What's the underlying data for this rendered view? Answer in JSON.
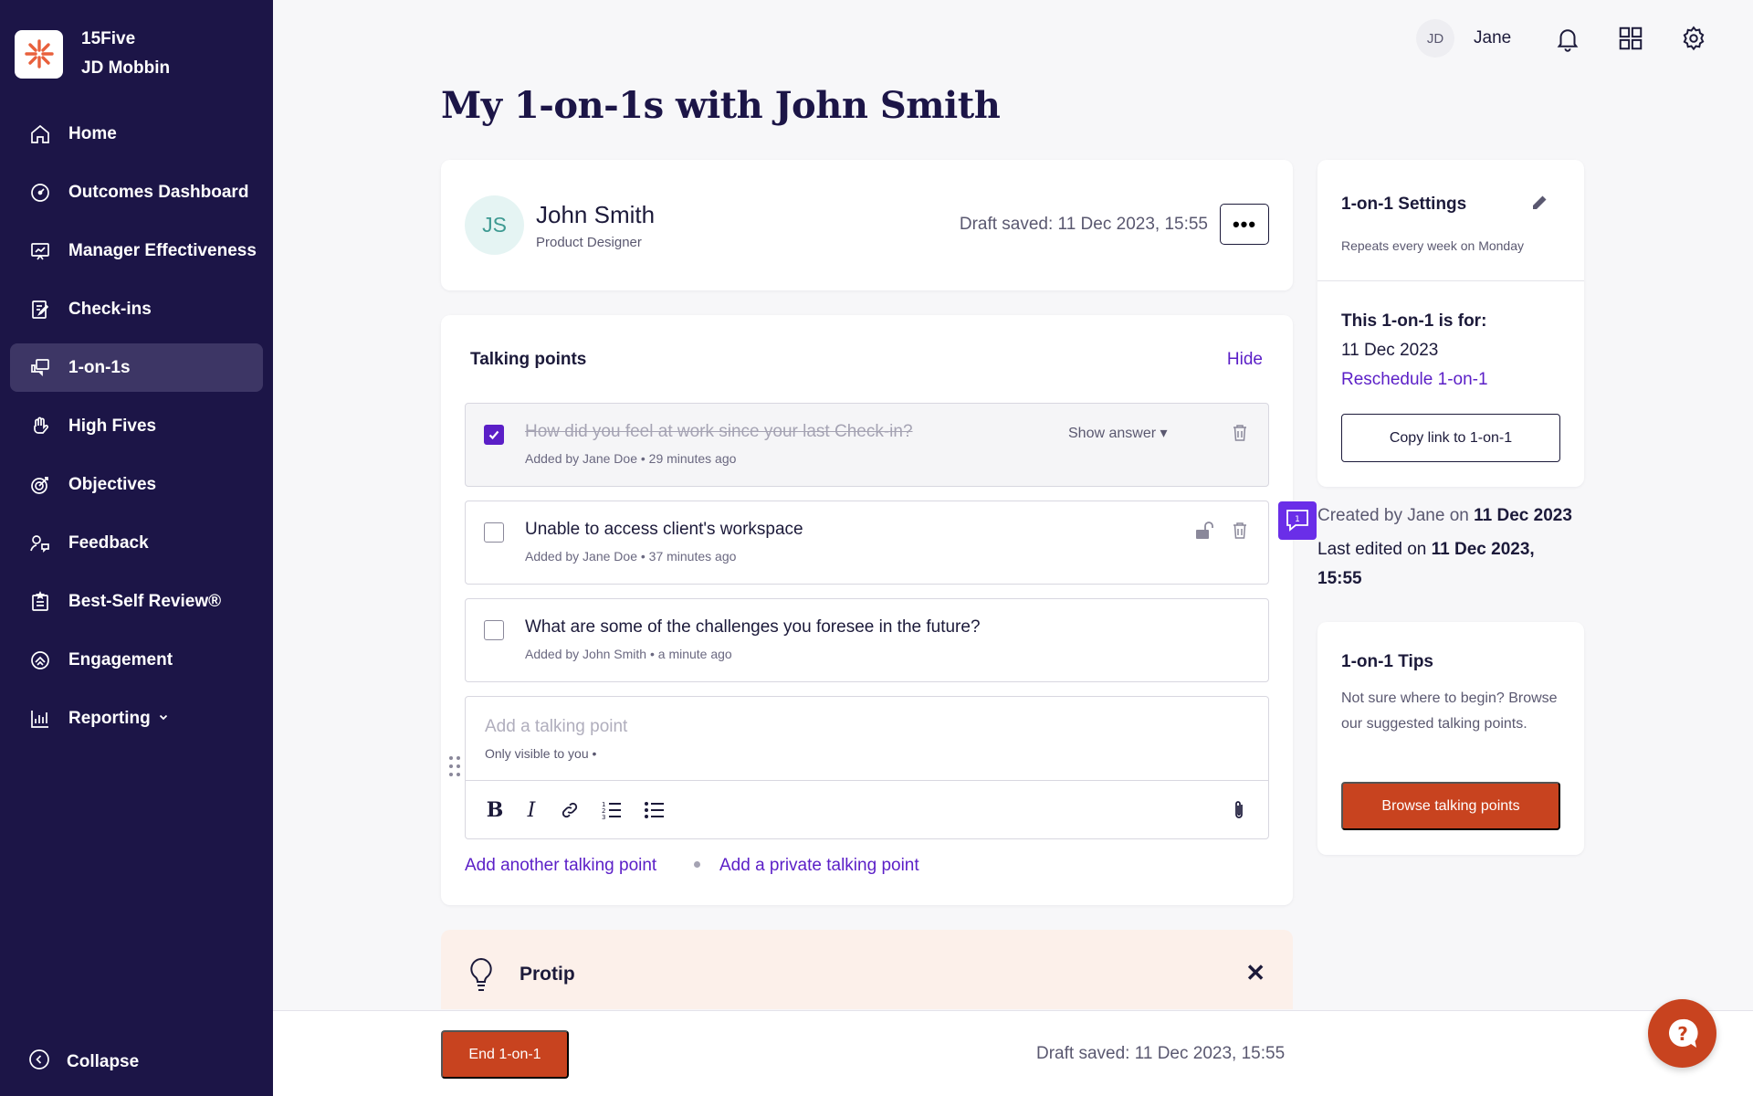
{
  "brand": {
    "company": "15Five",
    "user": "JD Mobbin"
  },
  "sidebar": {
    "items": [
      {
        "label": "Home",
        "icon": "home-icon"
      },
      {
        "label": "Outcomes Dashboard",
        "icon": "dashboard-gauge-icon"
      },
      {
        "label": "Manager Effectiveness",
        "icon": "chart-presentation-icon"
      },
      {
        "label": "Check-ins",
        "icon": "checkin-edit-icon"
      },
      {
        "label": "1-on-1s",
        "icon": "chat-bubbles-icon",
        "active": true
      },
      {
        "label": "High Fives",
        "icon": "high-five-hand-icon"
      },
      {
        "label": "Objectives",
        "icon": "target-icon"
      },
      {
        "label": "Feedback",
        "icon": "feedback-person-icon"
      },
      {
        "label": "Best-Self Review®",
        "icon": "review-clipboard-icon"
      },
      {
        "label": "Engagement",
        "icon": "engagement-icon"
      },
      {
        "label": "Reporting",
        "icon": "bar-chart-icon"
      }
    ],
    "collapse_label": "Collapse"
  },
  "topbar": {
    "avatar_initials": "JD",
    "user_name": "Jane"
  },
  "page": {
    "title": "My 1-on-1s with John Smith"
  },
  "person": {
    "initials": "JS",
    "name": "John Smith",
    "role": "Product Designer",
    "draft_saved": "Draft saved: 11 Dec 2023, 15:55",
    "more_label": "•••"
  },
  "talking_points": {
    "title": "Talking points",
    "hide_label": "Hide",
    "items": [
      {
        "text": "How did you feel at work since your last Check-in?",
        "meta": "Added by Jane Doe  •  29 minutes ago",
        "checked": true,
        "show_answer": "Show answer ▾"
      },
      {
        "text": "Unable to access client's workspace",
        "meta": "Added by Jane Doe  •  37 minutes ago",
        "checked": false
      },
      {
        "text": "What are some of the challenges you foresee in the future?",
        "meta": "Added by John Smith  •  a minute ago",
        "checked": false
      }
    ],
    "add_placeholder": "Add a talking point",
    "add_visibility": "Only visible to you  •",
    "add_another": "Add another talking point",
    "add_private": "Add a private talking point"
  },
  "protip": {
    "title": "Protip",
    "close": "✕"
  },
  "footer": {
    "end_label": "End 1-on-1",
    "draft_saved": "Draft saved: 11 Dec 2023, 15:55"
  },
  "settings": {
    "title": "1-on-1 Settings",
    "repeat": "Repeats every week on Monday",
    "for_label": "This 1-on-1 is for:",
    "for_date": "11 Dec 2023",
    "reschedule": "Reschedule 1-on-1",
    "copy_link": "Copy link to 1-on-1"
  },
  "history": {
    "created_prefix": "Created by Jane on ",
    "created_date": "11 Dec 2023",
    "edited_prefix": "Last edited on ",
    "edited_date": "11 Dec 2023, 15:55",
    "comment_count": "1"
  },
  "tips": {
    "title": "1-on-1 Tips",
    "body": "Not sure where to begin? Browse our suggested talking points.",
    "browse": "Browse talking points"
  },
  "colors": {
    "sidebar_bg": "#1c1547",
    "accent": "#5b1fc7",
    "primary_button": "#c8431f"
  }
}
